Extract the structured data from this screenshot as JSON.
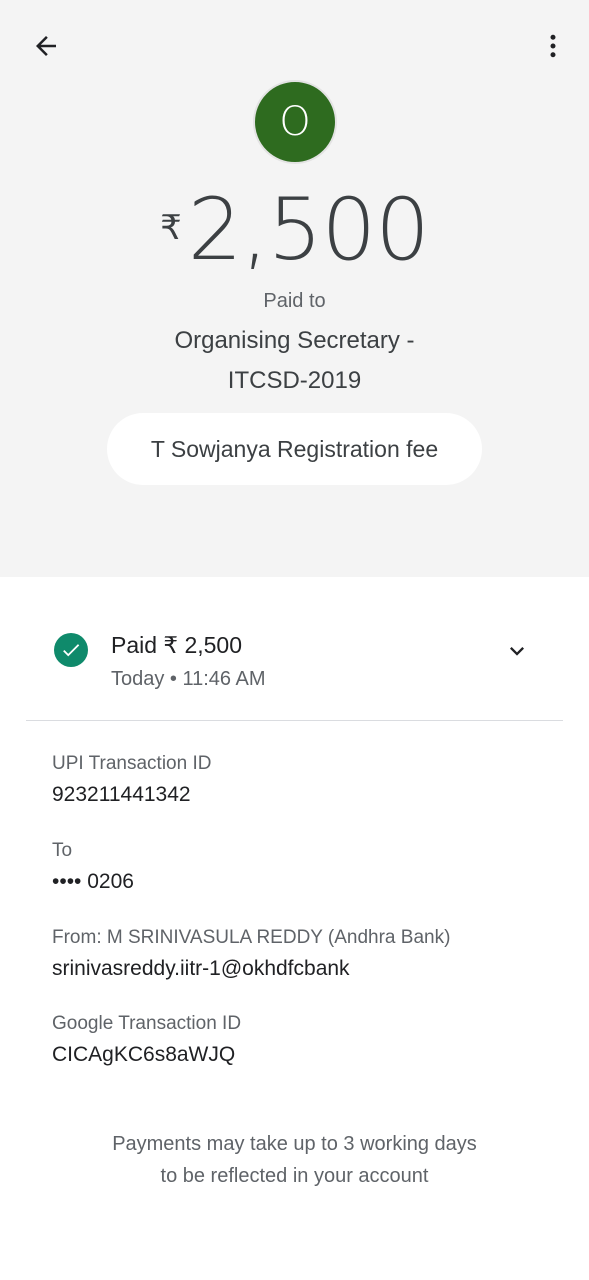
{
  "header": {
    "back_icon": "arrow-back-icon",
    "more_icon": "more-vert-icon"
  },
  "payee": {
    "avatar_letter": "O",
    "avatar_color": "#2e6b1f",
    "currency_symbol": "₹",
    "amount": "2,500",
    "paid_to_label": "Paid to",
    "name_line1": "Organising Secretary -",
    "name_line2": "ITCSD-2019",
    "note": "T Sowjanya Registration fee"
  },
  "status": {
    "icon": "check-circle-icon",
    "color": "#0f8a6b",
    "title": "Paid ₹ 2,500",
    "time": "Today • 11:46 AM",
    "expand_icon": "chevron-down-icon"
  },
  "details": {
    "upi_label": "UPI Transaction ID",
    "upi_value": "923211441342",
    "to_label": "To",
    "to_value": "•••• 0206",
    "from_label": "From: M SRINIVASULA REDDY (Andhra Bank)",
    "from_value": "srinivasreddy.iitr-1@okhdfcbank",
    "google_label": "Google Transaction ID",
    "google_value": "CICAgKC6s8aWJQ"
  },
  "footer": {
    "line1": "Payments may take up to 3 working days",
    "line2": "to be reflected in your account"
  }
}
